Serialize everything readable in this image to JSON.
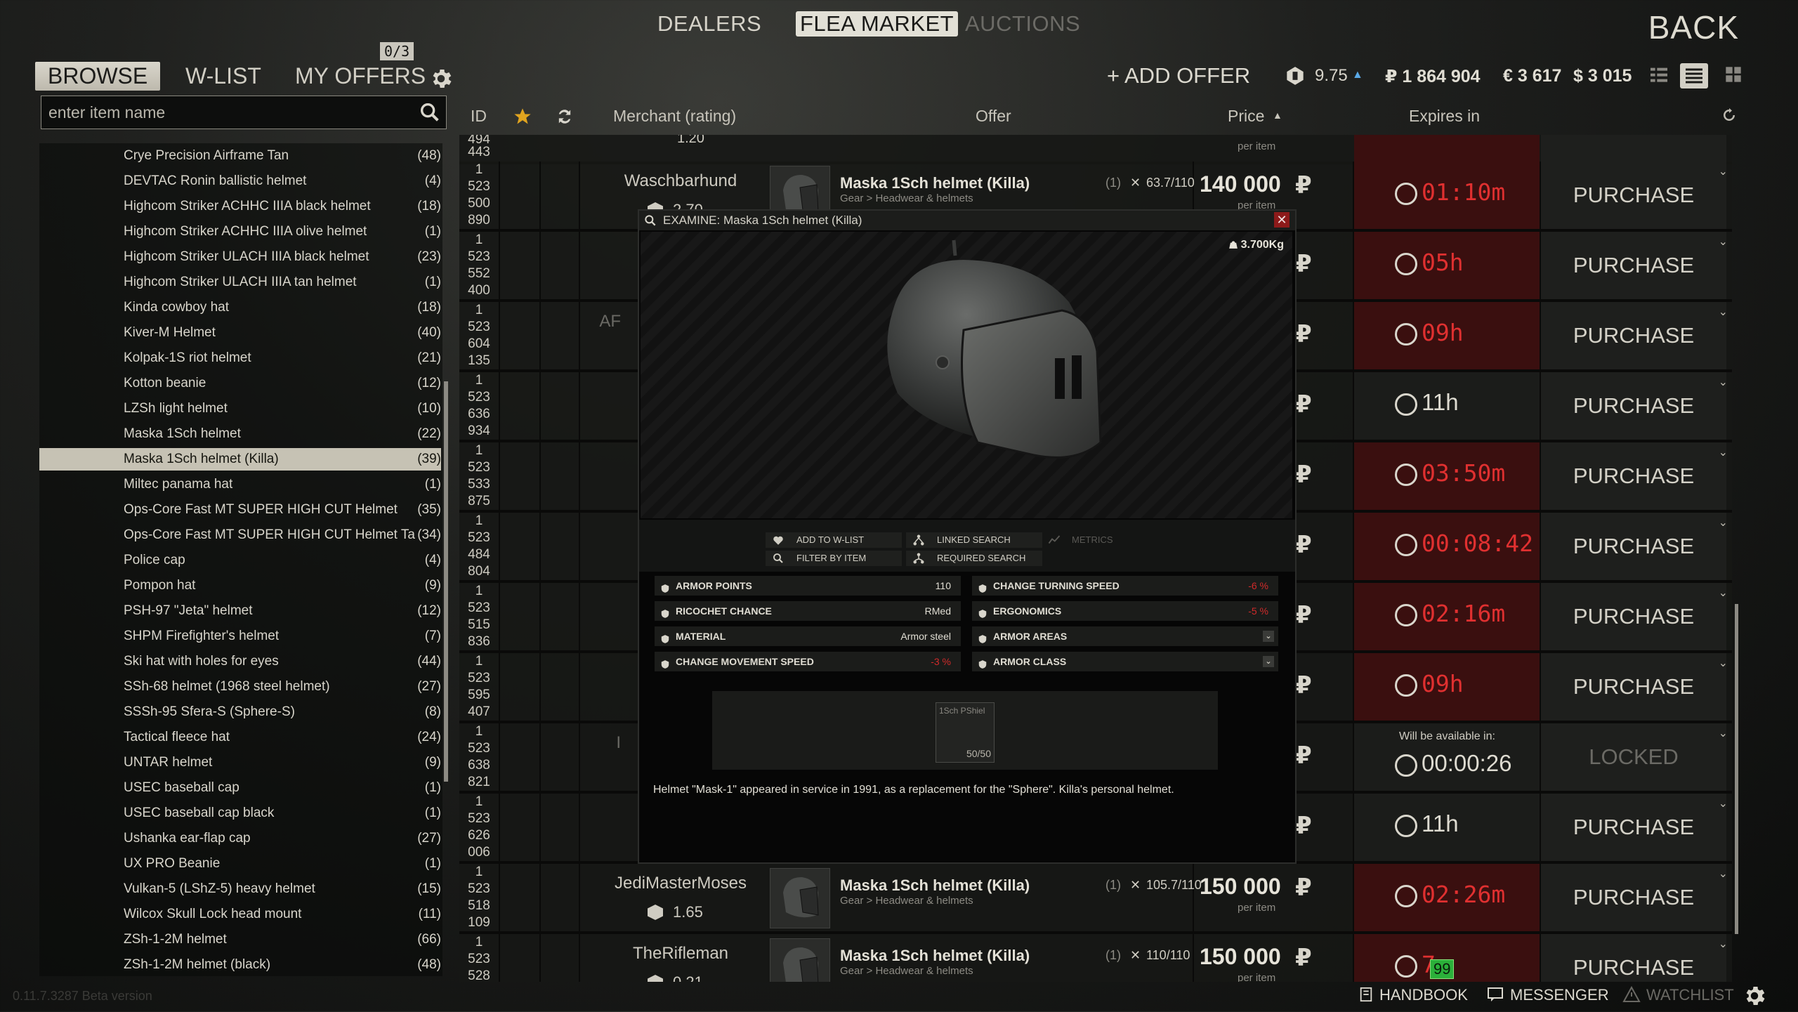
{
  "nav": {
    "dealers": "DEALERS",
    "flea": "FLEA MARKET",
    "auctions": "AUCTIONS",
    "back": "BACK"
  },
  "subnav": {
    "browse": "BROWSE",
    "wlist": "W-LIST",
    "myoffers": "MY OFFERS",
    "offers_count": "0/3"
  },
  "search": {
    "placeholder": "enter item name"
  },
  "categories": [
    {
      "name": "Crye Precision Airframe Tan",
      "count": "(48)"
    },
    {
      "name": "DEVTAC Ronin ballistic helmet",
      "count": "(4)"
    },
    {
      "name": "Highcom Striker ACHHC IIIA black helmet",
      "count": "(18)"
    },
    {
      "name": "Highcom Striker ACHHC IIIA olive helmet",
      "count": "(1)"
    },
    {
      "name": "Highcom Striker ULACH IIIA black helmet",
      "count": "(23)"
    },
    {
      "name": "Highcom Striker ULACH IIIA tan helmet",
      "count": "(1)"
    },
    {
      "name": "Kinda cowboy hat",
      "count": "(18)"
    },
    {
      "name": "Kiver-M Helmet",
      "count": "(40)"
    },
    {
      "name": "Kolpak-1S riot helmet",
      "count": "(21)"
    },
    {
      "name": "Kotton beanie",
      "count": "(12)"
    },
    {
      "name": "LZSh light helmet",
      "count": "(10)"
    },
    {
      "name": "Maska 1Sch helmet",
      "count": "(22)"
    },
    {
      "name": "Maska 1Sch helmet (Killa)",
      "count": "(39)"
    },
    {
      "name": "Miltec panama hat",
      "count": "(1)"
    },
    {
      "name": "Ops-Core Fast MT SUPER HIGH CUT Helmet",
      "count": "(35)"
    },
    {
      "name": "Ops-Core Fast MT SUPER HIGH CUT Helmet Ta",
      "count": "(34)"
    },
    {
      "name": "Police cap",
      "count": "(4)"
    },
    {
      "name": "Pompon hat",
      "count": "(9)"
    },
    {
      "name": "PSH-97 \"Jeta\" helmet",
      "count": "(12)"
    },
    {
      "name": "SHPM Firefighter's helmet",
      "count": "(7)"
    },
    {
      "name": "Ski hat with holes for eyes",
      "count": "(44)"
    },
    {
      "name": "SSh-68 helmet (1968 steel helmet)",
      "count": "(27)"
    },
    {
      "name": "SSSh-95 Sfera-S (Sphere-S)",
      "count": "(8)"
    },
    {
      "name": "Tactical fleece hat",
      "count": "(24)"
    },
    {
      "name": "UNTAR helmet",
      "count": "(9)"
    },
    {
      "name": "USEC baseball cap",
      "count": "(1)"
    },
    {
      "name": "USEC baseball cap black",
      "count": "(1)"
    },
    {
      "name": "Ushanka ear-flap cap",
      "count": "(27)"
    },
    {
      "name": "UX PRO Beanie",
      "count": "(1)"
    },
    {
      "name": "Vulkan-5 (LShZ-5) heavy helmet",
      "count": "(15)"
    },
    {
      "name": "Wilcox Skull Lock head mount",
      "count": "(11)"
    },
    {
      "name": "ZSh-1-2M helmet",
      "count": "(66)"
    },
    {
      "name": "ZSh-1-2M helmet (black)",
      "count": "(48)"
    }
  ],
  "toolbar": {
    "add_offer": "+ ADD OFFER",
    "rating": "9.75",
    "rub": "₽ 1 864 904",
    "eur": "€ 3 617",
    "usd": "$ 3 015"
  },
  "columns": {
    "id": "ID",
    "merchant": "Merchant (rating)",
    "offer": "Offer",
    "price": "Price",
    "expires": "Expires in"
  },
  "rows": [
    {
      "id": [
        "1",
        "523",
        "500",
        "890"
      ],
      "merchant": "Waschbarhund",
      "rating": "2.70",
      "item": "Maska 1Sch helmet (Killa)",
      "qty": "(1)",
      "dur": "63.7/110",
      "meta": "Gear > Headwear & helmets",
      "price": "140 000",
      "per": "per item",
      "expires": "01:10m",
      "red": true,
      "action": "PURCHASE"
    },
    {
      "id": [
        "1",
        "523",
        "552",
        "400"
      ],
      "expires": "05h",
      "red": true,
      "action": "PURCHASE"
    },
    {
      "id": [
        "1",
        "523",
        "604",
        "135"
      ],
      "merchant": "AF",
      "expires": "09h",
      "red": true,
      "action": "PURCHASE"
    },
    {
      "id": [
        "1",
        "523",
        "636",
        "934"
      ],
      "expires": "11h",
      "red": false,
      "action": "PURCHASE"
    },
    {
      "id": [
        "1",
        "523",
        "533",
        "875"
      ],
      "expires": "03:50m",
      "red": true,
      "action": "PURCHASE"
    },
    {
      "id": [
        "1",
        "523",
        "484",
        "804"
      ],
      "expires": "00:08:42",
      "red": true,
      "action": "PURCHASE"
    },
    {
      "id": [
        "1",
        "523",
        "515",
        "836"
      ],
      "expires": "02:16m",
      "red": true,
      "action": "PURCHASE"
    },
    {
      "id": [
        "1",
        "523",
        "595",
        "407"
      ],
      "expires": "09h",
      "red": true,
      "action": "PURCHASE"
    },
    {
      "id": [
        "1",
        "523",
        "638",
        "821"
      ],
      "merchant": "I",
      "expires": "00:00:26",
      "available": "Will be available in:",
      "red": false,
      "action": "LOCKED"
    },
    {
      "id": [
        "1",
        "523",
        "626",
        "006"
      ],
      "expires": "11h",
      "red": false,
      "action": "PURCHASE"
    },
    {
      "id": [
        "1",
        "523",
        "518",
        "109"
      ],
      "merchant": "JediMasterMoses",
      "rating": "1.65",
      "item": "Maska 1Sch helmet (Killa)",
      "qty": "(1)",
      "dur": "105.7/110",
      "meta": "Gear > Headwear & helmets",
      "price": "150 000",
      "per": "per item",
      "expires": "02:26m",
      "red": true,
      "action": "PURCHASE"
    },
    {
      "id": [
        "1",
        "523",
        "528"
      ],
      "merchant": "TheRifleman",
      "rating": "0.21",
      "item": "Maska 1Sch helmet (Killa)",
      "qty": "(1)",
      "dur": "110/110",
      "meta": "Gear > Headwear & helmets",
      "price": "150 000",
      "per": "per item",
      "expires": "7m",
      "red": true,
      "action": "PURCHASE"
    }
  ],
  "top_partial_row": {
    "id": [
      "494",
      "443"
    ],
    "rating": "1.20",
    "per": "per item"
  },
  "modal": {
    "title": "EXAMINE: Maska 1Sch helmet (Killa)",
    "weight": "3.700Kg",
    "add_wlist": "ADD TO W-LIST",
    "linked": "LINKED SEARCH",
    "metrics": "METRICS",
    "filter": "FILTER BY ITEM",
    "required": "REQUIRED SEARCH",
    "stats_left": [
      {
        "label": "ARMOR POINTS",
        "value": "110"
      },
      {
        "label": "RICOCHET CHANCE",
        "value": "RMed"
      },
      {
        "label": "MATERIAL",
        "value": "Armor steel"
      },
      {
        "label": "CHANGE MOVEMENT SPEED",
        "value": "-3 %"
      }
    ],
    "stats_right": [
      {
        "label": "CHANGE TURNING SPEED",
        "value": "-6 %"
      },
      {
        "label": "ERGONOMICS",
        "value": "-5 %"
      },
      {
        "label": "ARMOR AREAS",
        "value": ""
      },
      {
        "label": "ARMOR CLASS",
        "value": ""
      }
    ],
    "slot_name": "1Sch PShiel",
    "slot_dur": "50/50",
    "description": "Helmet \"Mask-1\" appeared in service in 1991, as a replacement for the \"Sphere\". Killa's personal helmet."
  },
  "footer": {
    "version": "0.11.7.3287 Beta version",
    "handbook": "HANDBOOK",
    "messenger": "MESSENGER",
    "watchlist": "WATCHLIST",
    "chat_count": "99"
  },
  "colors": {
    "accent_red": "#e03030",
    "expire_bg": "#3a0f0f",
    "selected_bg": "#c6c2b4"
  }
}
